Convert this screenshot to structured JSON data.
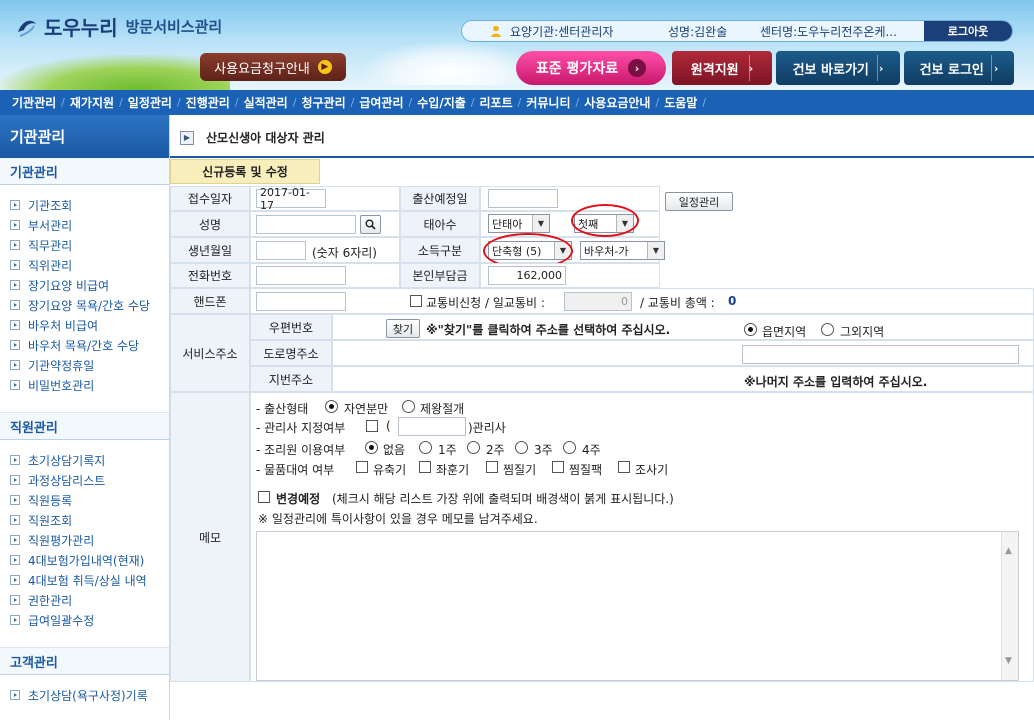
{
  "header": {
    "brand": "도우누리",
    "service": "방문서비스관리",
    "user_org": "요양기관:센터관리자",
    "user_name": "성명:김완술",
    "user_center": "센터명:도우누리전주온케...",
    "logout": "로그아웃",
    "fee_guide": "사용요금청구안내",
    "std_eval": "표준 평가자료",
    "remote": "원격지원",
    "nhis_go": "건보 바로가기",
    "nhis_login": "건보 로그인"
  },
  "nav": {
    "items": [
      "기관관리",
      "재가지원",
      "일정관리",
      "진행관리",
      "실적관리",
      "청구관리",
      "급여관리",
      "수입/지출",
      "리포트",
      "커뮤니티",
      "사용요금안내",
      "도움말"
    ]
  },
  "sidebar": {
    "title": "기관관리",
    "sections": [
      {
        "header": "기관관리",
        "items": [
          "기관조회",
          "부서관리",
          "직무관리",
          "직위관리",
          "장기요양 비급여",
          "장기요양 목욕/간호 수당",
          "바우처 비급여",
          "바우처 목욕/간호 수당",
          "기관약정휴일",
          "비밀번호관리"
        ]
      },
      {
        "header": "직원관리",
        "items": [
          "초기상담기록지",
          "과정상담리스트",
          "직원등록",
          "직원조회",
          "직원평가관리",
          "4대보험가입내역(현재)",
          "4대보험 취득/상실 내역",
          "권한관리",
          "급여일괄수정"
        ]
      },
      {
        "header": "고객관리",
        "items": [
          "초기상담(욕구사정)기록"
        ]
      }
    ]
  },
  "main": {
    "page_title": "산모신생아 대상자 관리",
    "tab": "신규등록 및 수정",
    "form": {
      "receipt_date_label": "접수일자",
      "receipt_date": "2017-01-17",
      "due_date_label": "출산예정일",
      "due_date": "",
      "schedule_btn": "일정관리",
      "name_label": "성명",
      "name": "",
      "fetus_label": "태아수",
      "fetus_type": "단태아",
      "birth_order": "첫째",
      "birth_label": "생년월일",
      "birth": "",
      "birth_hint": "(숫자 6자리)",
      "income_label": "소득구분",
      "income_type": "단축형 (5)",
      "voucher_type": "바우처-가",
      "phone_label": "전화번호",
      "phone": "",
      "copay_label": "본인부담금",
      "copay": "162,000",
      "mobile_label": "핸드폰",
      "mobile": "",
      "transport_text": "교통비신청 / 일교통비 :",
      "transport_daily": "0",
      "transport_total_text": "/ 교통비 총액 :",
      "transport_total": "0",
      "service_address_label": "서비스주소",
      "postal_label": "우편번호",
      "find_btn": "찾기",
      "find_hint": "※\"찾기\"를 클릭하여 주소를 선택하여 주십시오.",
      "region_in": "읍면지역",
      "region_out": "그외지역",
      "road_label": "도로명주소",
      "lot_label": "지번주소",
      "rest_hint": "※나머지 주소를 입력하여 주십시오.",
      "memo_label": "메모",
      "birth_type_label": "- 출산형태",
      "birth_natural": "자연분만",
      "birth_csection": "제왕절개",
      "manager_label": "- 관리사 지정여부",
      "manager_paren_open": "(",
      "manager_paren_close": ")관리사",
      "manager_value": "",
      "care_label": "- 조리원 이용여부",
      "care_none": "없음",
      "care_1": "1주",
      "care_2": "2주",
      "care_3": "3주",
      "care_4": "4주",
      "rental_label": "- 물품대여 여부",
      "rental_items": [
        "유축기",
        "좌훈기",
        "찜질기",
        "찜질팩",
        "조사기"
      ],
      "change_label": "변경예정",
      "change_hint": "(체크시 해당 리스트 가장 위에 출력되며 배경색이 붉게 표시됩니다.)",
      "memo_hint": "※ 일정관리에 특이사항이 있을 경우 메모를 남겨주세요."
    }
  }
}
